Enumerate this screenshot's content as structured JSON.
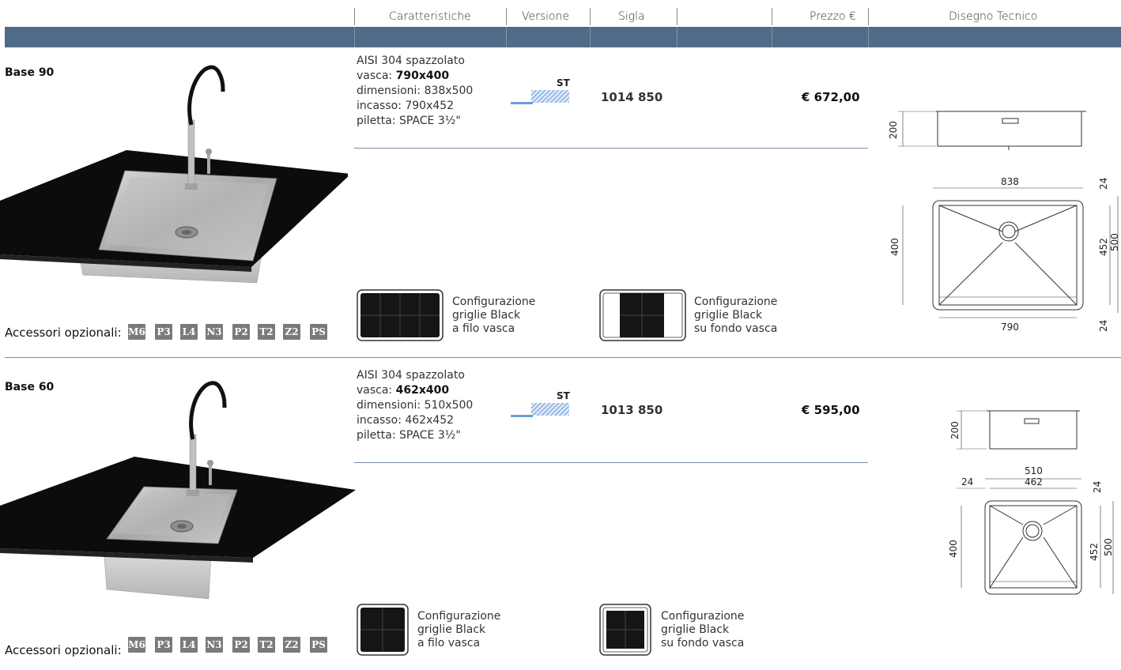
{
  "header": {
    "col_caratteristiche": "Caratteristiche",
    "col_versione": "Versione",
    "col_sigla": "Sigla",
    "col_prezzo": "Prezzo €",
    "col_disegno": "Disegno Tecnico"
  },
  "products": [
    {
      "title": "Base 90",
      "spec_material": "AISI 304 spazzolato",
      "spec_vasca_label": "vasca: ",
      "spec_vasca_value": "790x400",
      "spec_dimensioni": "dimensioni: 838x500",
      "spec_incasso": "incasso: 790x452",
      "spec_piletta": "piletta: SPACE 3½\"",
      "version": "ST",
      "code": "1014 850",
      "price": "€ 672,00",
      "config_flush": [
        "Configurazione",
        "griglie Black",
        "a filo vasca"
      ],
      "config_bottom": [
        "Configurazione",
        "griglie Black",
        "su fondo vasca"
      ],
      "accessories_label": "Accessori opzionali:",
      "accessories": [
        "M6",
        "P3",
        "L4",
        "N3",
        "P2",
        "T2",
        "Z2",
        "PS"
      ],
      "drawing": {
        "side_height": "200",
        "width_total": "838",
        "width_bowl": "790",
        "depth_bowl": "400",
        "depth_cut": "452",
        "depth_total": "500",
        "edge_top": "24",
        "edge_bottom": "24"
      }
    },
    {
      "title": "Base 60",
      "spec_material": "AISI 304 spazzolato",
      "spec_vasca_label": "vasca: ",
      "spec_vasca_value": "462x400",
      "spec_dimensioni": "dimensioni: 510x500",
      "spec_incasso": "incasso: 462x452",
      "spec_piletta": "piletta: SPACE 3½\"",
      "version": "ST",
      "code": "1013 850",
      "price": "€ 595,00",
      "config_flush": [
        "Configurazione",
        "griglie Black",
        "a filo vasca"
      ],
      "config_bottom": [
        "Configurazione",
        "griglie Black",
        "su fondo vasca"
      ],
      "accessories_label": "Accessori opzionali:",
      "accessories": [
        "M6",
        "P3",
        "L4",
        "N3",
        "P2",
        "T2",
        "Z2",
        "PS"
      ],
      "drawing": {
        "side_height": "200",
        "width_total": "510",
        "width_bowl": "462",
        "depth_bowl": "400",
        "depth_cut": "452",
        "depth_total": "500",
        "edge_left": "24",
        "edge_top": "24"
      }
    }
  ],
  "colors": {
    "header_band": "#4f6b88",
    "divider": "#7b8fa6",
    "badge": "#7a7a7a",
    "st_blue": "#6b9ee0"
  }
}
